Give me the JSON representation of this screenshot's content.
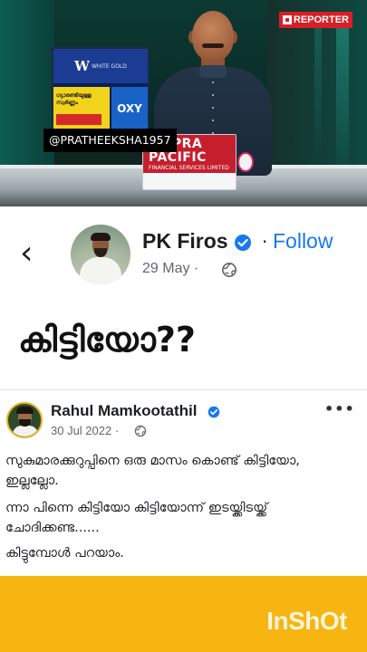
{
  "video": {
    "channel_logo": "REPORTER",
    "overlay_handle": "@PRATHEEKSHA1957",
    "desk_logo_line1": "UPRA",
    "desk_logo_line2": "PACIFIC",
    "desk_logo_line3": "FINANCIAL SERVICES LIMITED",
    "screen_brand": "WHITE GOLD",
    "screen_promo": "ഗ്യാരണ്ടിയുള്ള സ്വർണ്ണം",
    "screen_tag": "OXY"
  },
  "post_header": {
    "back_icon": "chevron-left-icon",
    "author": "PK Firos",
    "verified_icon": "verified-badge-icon",
    "separator": "·",
    "follow_label": "Follow",
    "date": "29 May",
    "date_separator": "·",
    "privacy_icon": "globe-icon"
  },
  "headline": "കിട്ടിയോ??",
  "shared_post": {
    "author": "Rahul Mamkootathil",
    "verified_icon": "verified-badge-icon",
    "date": "30 Jul 2022",
    "date_separator": "·",
    "privacy_icon": "globe-icon",
    "more_label": "•••",
    "lines": [
      "സുകുമാരക്കുറുപ്പിനെ ഒരു മാസം കൊണ്ട് കിട്ടിയോ,",
      "ഇല്ലല്ലോ.",
      " ന്നാ പിന്നെ കിട്ടിയോ കിട്ടിയോന്ന് ഇടയ്ക്കിടയ്ക്ക്",
      "ചോദിക്കണ്ട......",
      "കിട്ടുമ്പോൾ പറയാം."
    ]
  },
  "watermark": "InShOt",
  "colors": {
    "facebook_blue": "#1877f2",
    "band_yellow": "#f6b511",
    "reporter_red": "#d71f26"
  }
}
